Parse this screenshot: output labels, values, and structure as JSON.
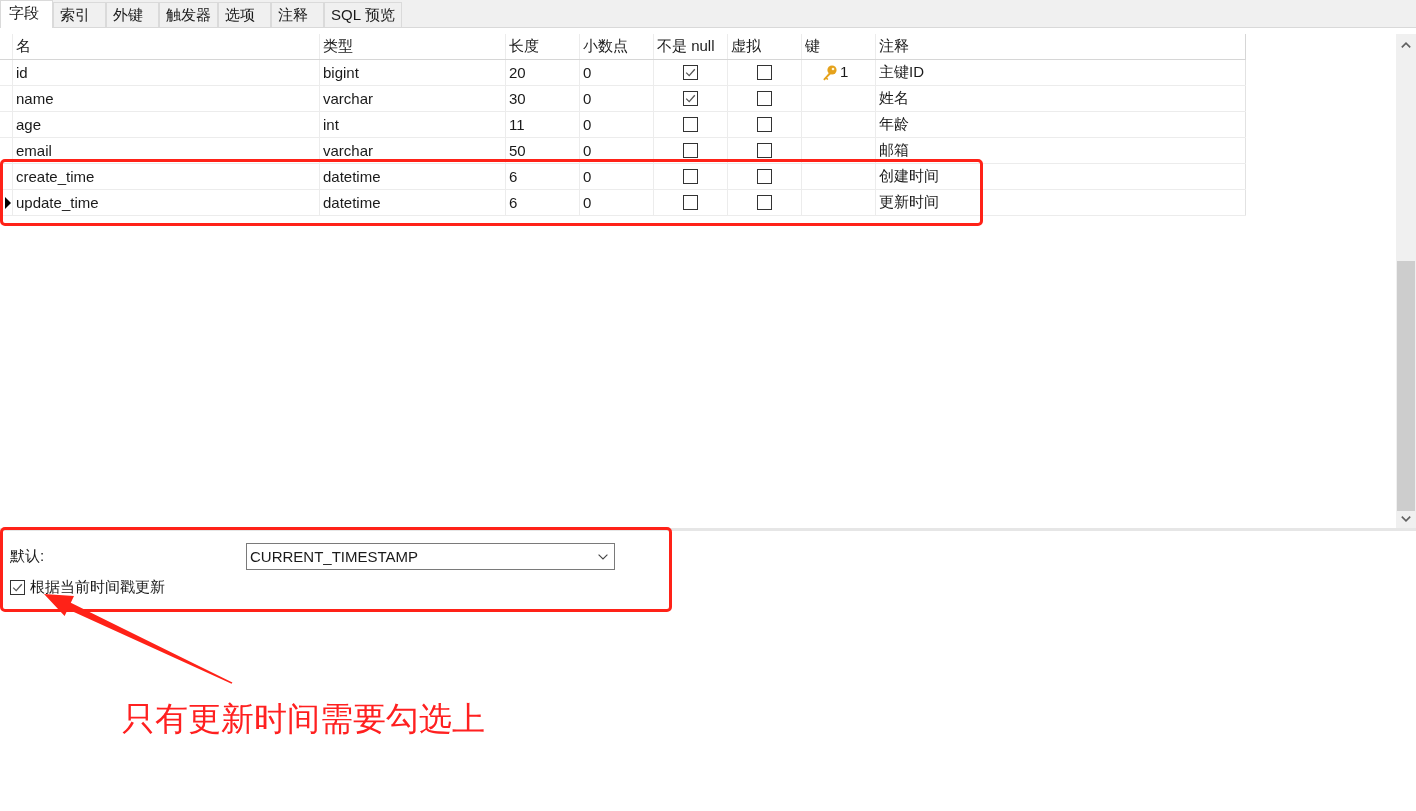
{
  "tabs": [
    {
      "label": "字段",
      "selected": true
    },
    {
      "label": "索引",
      "selected": false
    },
    {
      "label": "外键",
      "selected": false
    },
    {
      "label": "触发器",
      "selected": false
    },
    {
      "label": "选项",
      "selected": false
    },
    {
      "label": "注释",
      "selected": false
    },
    {
      "label": "SQL 预览",
      "selected": false
    }
  ],
  "fields_table": {
    "columns": [
      "名",
      "类型",
      "长度",
      "小数点",
      "不是 null",
      "虚拟",
      "键",
      "注释"
    ],
    "rows": [
      {
        "current": false,
        "name": "id",
        "type": "bigint",
        "length": "20",
        "decimals": "0",
        "not_null": true,
        "virtual": false,
        "key": "1",
        "comment": "主键ID"
      },
      {
        "current": false,
        "name": "name",
        "type": "varchar",
        "length": "30",
        "decimals": "0",
        "not_null": true,
        "virtual": false,
        "comment": "姓名"
      },
      {
        "current": false,
        "name": "age",
        "type": "int",
        "length": "11",
        "decimals": "0",
        "not_null": false,
        "virtual": false,
        "comment": "年龄"
      },
      {
        "current": false,
        "name": "email",
        "type": "varchar",
        "length": "50",
        "decimals": "0",
        "not_null": false,
        "virtual": false,
        "comment": "邮箱"
      },
      {
        "current": false,
        "name": "create_time",
        "type": "datetime",
        "length": "6",
        "decimals": "0",
        "not_null": false,
        "virtual": false,
        "comment": "创建时间"
      },
      {
        "current": true,
        "name": "update_time",
        "type": "datetime",
        "length": "6",
        "decimals": "0",
        "not_null": false,
        "virtual": false,
        "comment": "更新时间"
      }
    ]
  },
  "field_options": {
    "default_label": "默认:",
    "default_value": "CURRENT_TIMESTAMP",
    "on_update": {
      "label": "根据当前时间戳更新",
      "checked": true
    }
  },
  "annotation": {
    "note": "只有更新时间需要勾选上"
  }
}
